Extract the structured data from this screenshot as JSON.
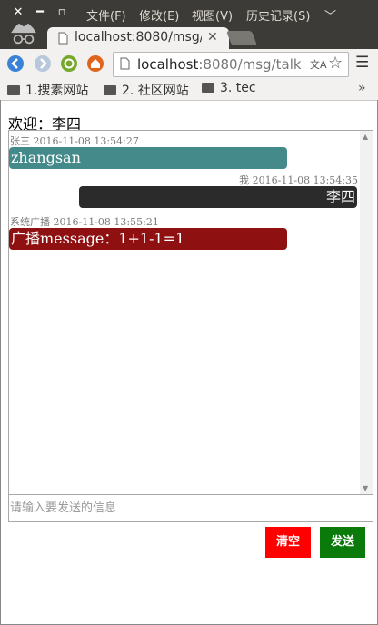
{
  "window": {
    "menu": [
      "文件(F)",
      "修改(E)",
      "视图(V)",
      "历史记录(S)"
    ]
  },
  "tab": {
    "title": "localhost:8080/msg/"
  },
  "address": {
    "host": "localhost",
    "rest": ":8080/msg/talk"
  },
  "bookmarks": [
    "1.搜素网站",
    "2. 社区网站",
    "3. tec"
  ],
  "page": {
    "welcome": "欢迎：李四",
    "messages": [
      {
        "meta": "张三 2016-11-08 13:54:27",
        "text": "zhangsan",
        "color": "#448a8a"
      },
      {
        "meta": "我 2016-11-08 13:54:35",
        "text": "李四",
        "color": "#2b2b2b"
      },
      {
        "meta": "系统广播 2016-11-08 13:55:21",
        "text": "广播message：1+1-1=1",
        "color": "#8e1010"
      }
    ],
    "input_placeholder": "请输入要发送的信息",
    "clear_label": "清空",
    "send_label": "发送",
    "clear_color": "#ff0000",
    "send_color": "#0a7a0a"
  }
}
